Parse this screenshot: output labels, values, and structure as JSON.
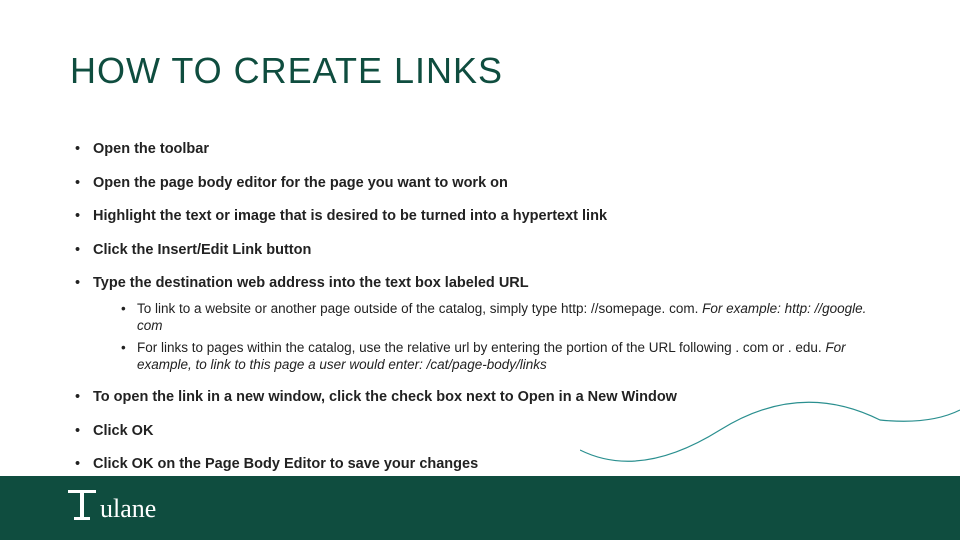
{
  "title": "HOW TO CREATE LINKS",
  "bullets": [
    {
      "text": "Open the toolbar"
    },
    {
      "text": "Open the page body editor for the page you want to work on"
    },
    {
      "text": "Highlight the text or image that is desired to be turned into a hypertext link"
    },
    {
      "text": "Click the Insert/Edit Link button"
    },
    {
      "prefix": "Type the destination web address into the text box labeled ",
      "bold_suffix": "URL",
      "sub": [
        {
          "plain": "To link to a website or another page outside of the catalog, simply type http: //somepage. com. ",
          "italic": "For example: http: //google. com"
        },
        {
          "plain": "For links to pages within the catalog, use the relative url by entering the portion of the URL following . com or . edu. ",
          "italic": "For example, to link to this page a user would enter: /cat/page-body/links"
        }
      ]
    },
    {
      "text": "To open the link in a new window, click the check box next to Open in a New Window"
    },
    {
      "text": "Click OK"
    },
    {
      "text": "Click OK on the Page Body Editor to save your changes"
    }
  ],
  "logo_text": "Tulane",
  "colors": {
    "brand": "#0f4d3f",
    "wave": "#2a8f8f"
  }
}
